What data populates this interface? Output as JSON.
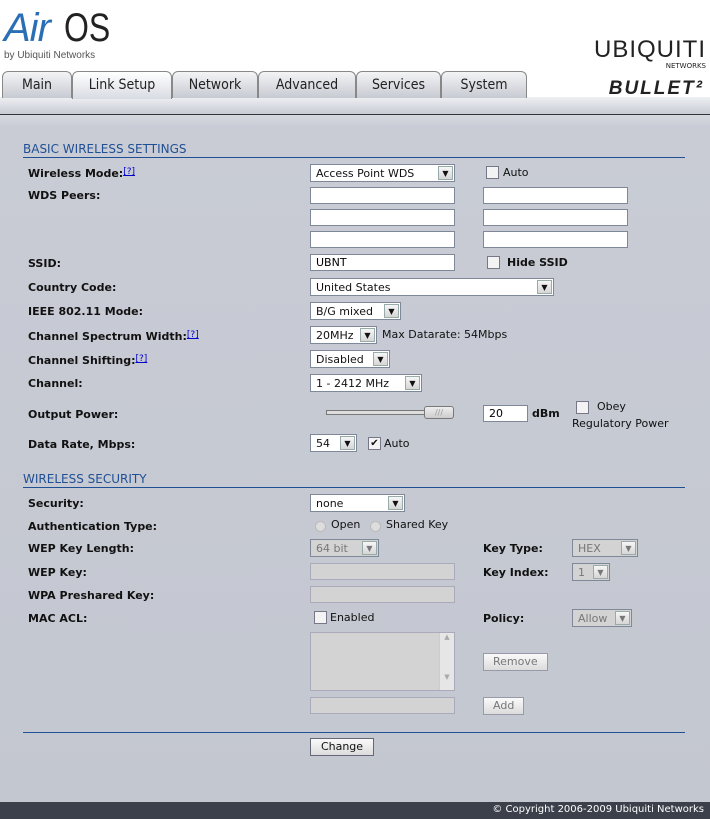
{
  "header": {
    "logo_air": "Air",
    "logo_os": "OS",
    "logo_by": "by Ubiquiti Networks",
    "brand": "UBIQUITI",
    "brand_sub": "NETWORKS",
    "product": "BULLET²"
  },
  "tabs": [
    {
      "label": "Main"
    },
    {
      "label": "Link Setup",
      "active": true
    },
    {
      "label": "Network"
    },
    {
      "label": "Advanced"
    },
    {
      "label": "Services"
    },
    {
      "label": "System"
    }
  ],
  "basic": {
    "title": "BASIC WIRELESS SETTINGS",
    "help": "[?]",
    "wireless_mode": {
      "label": "Wireless Mode:",
      "value": "Access Point WDS",
      "auto_label": "Auto",
      "auto": false
    },
    "wds_peers": {
      "label": "WDS Peers:",
      "values": [
        "",
        "",
        "",
        "",
        "",
        ""
      ]
    },
    "ssid": {
      "label": "SSID:",
      "value": "UBNT",
      "hide_label": "Hide SSID",
      "hide": false
    },
    "country": {
      "label": "Country Code:",
      "value": "United States"
    },
    "ieee_mode": {
      "label": "IEEE 802.11 Mode:",
      "value": "B/G mixed"
    },
    "spectrum": {
      "label": "Channel Spectrum Width:",
      "value": "20MHz",
      "max_datarate": "Max Datarate: 54Mbps"
    },
    "shifting": {
      "label": "Channel Shifting:",
      "value": "Disabled"
    },
    "channel": {
      "label": "Channel:",
      "value": "1 - 2412 MHz"
    },
    "output_power": {
      "label": "Output Power:",
      "value": "20",
      "unit": "dBm",
      "slider_fraction": 1.0,
      "obey_label": "Obey",
      "obey_label2": "Regulatory Power",
      "obey": false
    },
    "data_rate": {
      "label": "Data Rate, Mbps:",
      "value": "54",
      "auto_label": "Auto",
      "auto": true
    }
  },
  "security": {
    "title": "WIRELESS SECURITY",
    "security": {
      "label": "Security:",
      "value": "none"
    },
    "auth": {
      "label": "Authentication Type:",
      "open": "Open",
      "shared": "Shared Key"
    },
    "wep_len": {
      "label": "WEP Key Length:",
      "value": "64 bit"
    },
    "key_type": {
      "label": "Key Type:",
      "value": "HEX"
    },
    "wep_key": {
      "label": "WEP Key:",
      "value": ""
    },
    "key_index": {
      "label": "Key Index:",
      "value": "1"
    },
    "wpa": {
      "label": "WPA Preshared Key:",
      "value": ""
    },
    "mac_acl": {
      "label": "MAC ACL:",
      "enabled_label": "Enabled",
      "enabled": false
    },
    "policy": {
      "label": "Policy:",
      "value": "Allow"
    },
    "remove": "Remove",
    "add": "Add"
  },
  "change": "Change",
  "footer": "© Copyright 2006-2009 Ubiquiti Networks"
}
